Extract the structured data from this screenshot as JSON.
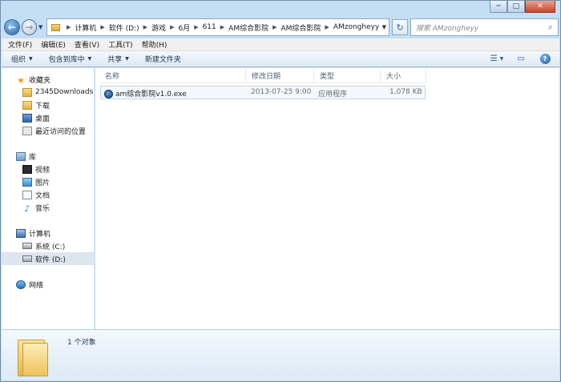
{
  "window": {
    "minimize": "─",
    "maximize": "□",
    "close": "✕"
  },
  "address": {
    "crumbs": [
      "计算机",
      "软件 (D:)",
      "游戏",
      "6月",
      "611",
      "AM综合影院",
      "AM综合影院",
      "AMzongheyy"
    ]
  },
  "search": {
    "placeholder": "搜索 AMzongheyy"
  },
  "menu": [
    "文件(F)",
    "编辑(E)",
    "查看(V)",
    "工具(T)",
    "帮助(H)"
  ],
  "toolbar": {
    "organize": "组织",
    "include_in_library": "包含到库中",
    "share": "共享",
    "new_folder": "新建文件夹"
  },
  "sidebar": {
    "favorites": {
      "label": "收藏夹",
      "items": [
        "2345Downloads",
        "下载",
        "桌面",
        "最近访问的位置"
      ]
    },
    "libraries": {
      "label": "库",
      "items": [
        "视频",
        "图片",
        "文档",
        "音乐"
      ]
    },
    "computer": {
      "label": "计算机",
      "items": [
        "系统 (C:)",
        "软件 (D:)"
      ],
      "selected": "软件 (D:)"
    },
    "network": {
      "label": "网络"
    }
  },
  "columns": {
    "name": "名称",
    "date": "修改日期",
    "type": "类型",
    "size": "大小"
  },
  "files": [
    {
      "name": "am综合影院v1.0.exe",
      "date": "2013-07-25 9:00",
      "type": "应用程序",
      "size": "1,078 KB"
    }
  ],
  "details": {
    "count": "1 个对象"
  }
}
